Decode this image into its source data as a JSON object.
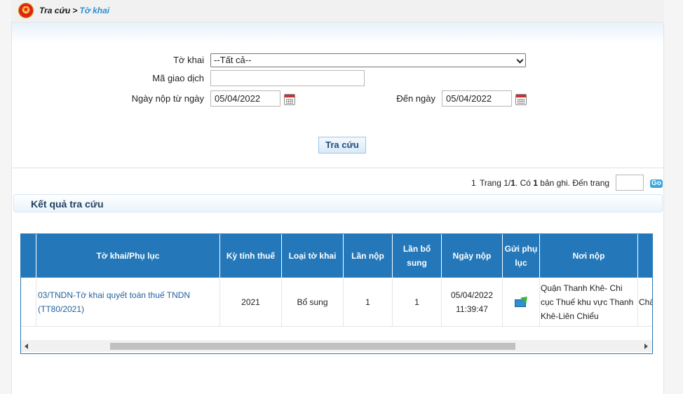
{
  "breadcrumb": {
    "root": "Tra cứu",
    "separator": ">",
    "current": "Tờ khai"
  },
  "form": {
    "to_khai_label": "Tờ khai",
    "to_khai_value": "--Tất cả--",
    "ma_giao_dich_label": "Mã giao dịch",
    "ma_giao_dich_value": "",
    "ngay_nop_tu_label": "Ngày nộp từ ngày",
    "ngay_nop_tu_value": "05/04/2022",
    "den_ngay_label": "Đến ngày",
    "den_ngay_value": "05/04/2022",
    "search_button": "Tra cứu"
  },
  "pager": {
    "current_page": "1",
    "page_text_prefix": "Trang 1/",
    "total_pages": "1",
    "records_prefix": ". Có ",
    "record_count": "1",
    "records_suffix": " bản ghi. Đến trang",
    "go_label": "Go"
  },
  "results": {
    "title": "Kết quả tra cứu",
    "columns": [
      "Tờ khai/Phụ lục",
      "Kỳ tính thuế",
      "Loại tờ khai",
      "Lần nộp",
      "Lần bổ sung",
      "Ngày nộp",
      "Gửi phụ lục",
      "Nơi nộp"
    ],
    "rows": [
      {
        "to_khai": "03/TNDN-Tờ khai quyết toán thuế TNDN (TT80/2021)",
        "ky_tinh_thue": "2021",
        "loai_to_khai": "Bổ sung",
        "lan_nop": "1",
        "lan_bo_sung": "1",
        "ngay_nop_date": "05/04/2022",
        "ngay_nop_time": "11:39:47",
        "gui_phu_luc_icon": "send-document-icon",
        "noi_nop": "Quận Thanh Khê- Chi cục Thuế khu vực Thanh Khê-Liên Chiểu",
        "next_col_partial": "Chấ"
      }
    ]
  },
  "colors": {
    "header_blue": "#2478b9",
    "link_blue": "#1f5f9e",
    "breadcrumb_accent": "#2a8fd6"
  }
}
